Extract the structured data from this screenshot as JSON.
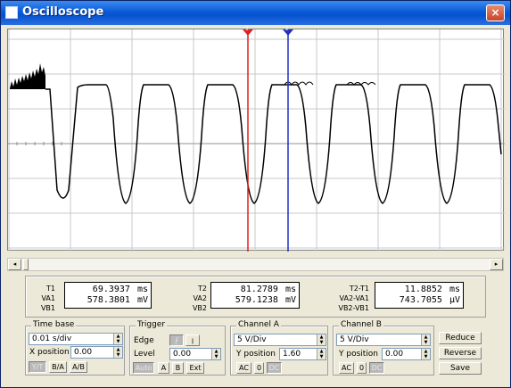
{
  "window": {
    "title": "Oscilloscope",
    "close": "×"
  },
  "colors": {
    "cursor1": "#e02020",
    "cursor2": "#2030c0",
    "trace": "#000000",
    "titlebar": "#0a5bd8"
  },
  "cursors": {
    "t1_label": "1",
    "t2_label": "2"
  },
  "scrollbar": {
    "left": "◂",
    "right": "▸"
  },
  "readouts": {
    "t1": {
      "labels": [
        "T1",
        "VA1",
        "VB1"
      ],
      "values": [
        [
          "69.3937",
          "ms"
        ],
        [
          "578.3801",
          "mV"
        ],
        [
          "",
          ""
        ]
      ]
    },
    "t2": {
      "labels": [
        "T2",
        "VA2",
        "VB2"
      ],
      "values": [
        [
          "81.2789",
          "ms"
        ],
        [
          "579.1238",
          "mV"
        ],
        [
          "",
          ""
        ]
      ]
    },
    "diff": {
      "labels": [
        "T2-T1",
        "VA2-VA1",
        "VB2-VB1"
      ],
      "values": [
        [
          "11.8852",
          "ms"
        ],
        [
          "743.7055",
          "µV"
        ],
        [
          "",
          ""
        ]
      ]
    }
  },
  "timebase": {
    "title": "Time base",
    "value": "0.01 s/div",
    "xpos_label": "X position",
    "xpos": "0.00",
    "btn_yt": "Y/T",
    "btn_ba": "B/A",
    "btn_ab": "A/B"
  },
  "trigger": {
    "title": "Trigger",
    "edge_label": "Edge",
    "level_label": "Level",
    "level": "0.00",
    "btn_auto": "Auto",
    "btn_a": "A",
    "btn_b": "B",
    "btn_ext": "Ext"
  },
  "channel_a": {
    "title": "Channel A",
    "value": "5 V/Div",
    "ypos_label": "Y position",
    "ypos": "1.60",
    "btn_ac": "AC",
    "btn_0": "0",
    "btn_dc": "DC"
  },
  "channel_b": {
    "title": "Channel B",
    "value": "5 V/Div",
    "ypos_label": "Y position",
    "ypos": "0.00",
    "btn_ac": "AC",
    "btn_0": "0",
    "btn_dc": "DC"
  },
  "actions": {
    "reduce": "Reduce",
    "reverse": "Reverse",
    "save": "Save"
  }
}
